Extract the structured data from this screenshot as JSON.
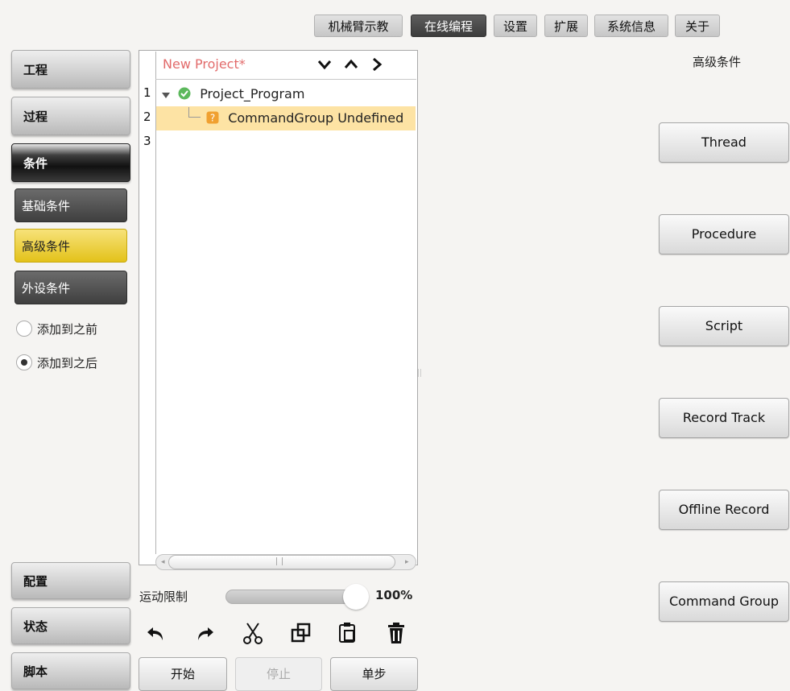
{
  "top_tabs": [
    {
      "label": "机械臂示教",
      "active": false
    },
    {
      "label": "在线编程",
      "active": true
    },
    {
      "label": "设置",
      "active": false
    },
    {
      "label": "扩展",
      "active": false
    },
    {
      "label": "系统信息",
      "active": false
    },
    {
      "label": "关于",
      "active": false
    }
  ],
  "left_nav": {
    "project": "工程",
    "process": "过程",
    "condition": "条件",
    "sub_items": [
      "基础条件",
      "高级条件",
      "外设条件"
    ],
    "radios": [
      "添加到之前",
      "添加到之后"
    ],
    "config": "配置",
    "status": "状态",
    "script": "脚本"
  },
  "editor": {
    "project_title": "New Project*",
    "nav_icons": [
      "chevron-down-icon",
      "chevron-up-icon",
      "chevron-right-icon"
    ],
    "line_numbers": [
      "1",
      "2",
      "3"
    ],
    "tree": [
      {
        "label": "Project_Program",
        "icon": "check-circle-icon"
      },
      {
        "label": "CommandGroup Undefined",
        "icon": "question-box-icon",
        "selected": true
      }
    ]
  },
  "speed": {
    "label": "运动限制",
    "value_text": "100%",
    "value": 100
  },
  "toolbar_icons": [
    "undo-icon",
    "redo-icon",
    "cut-icon",
    "copy-icon",
    "paste-icon",
    "delete-icon"
  ],
  "run_buttons": {
    "start": "开始",
    "stop": "停止",
    "step": "单步"
  },
  "right_panel": {
    "title": "高级条件",
    "buttons": [
      "Thread",
      "Procedure",
      "Script",
      "Record Track",
      "Offline Record",
      "Command Group"
    ]
  },
  "colors": {
    "accent_yellow": "#e7c62a",
    "project_title": "#e26b6b",
    "selected_row": "#fde3a4",
    "active_tab": "#444444"
  }
}
